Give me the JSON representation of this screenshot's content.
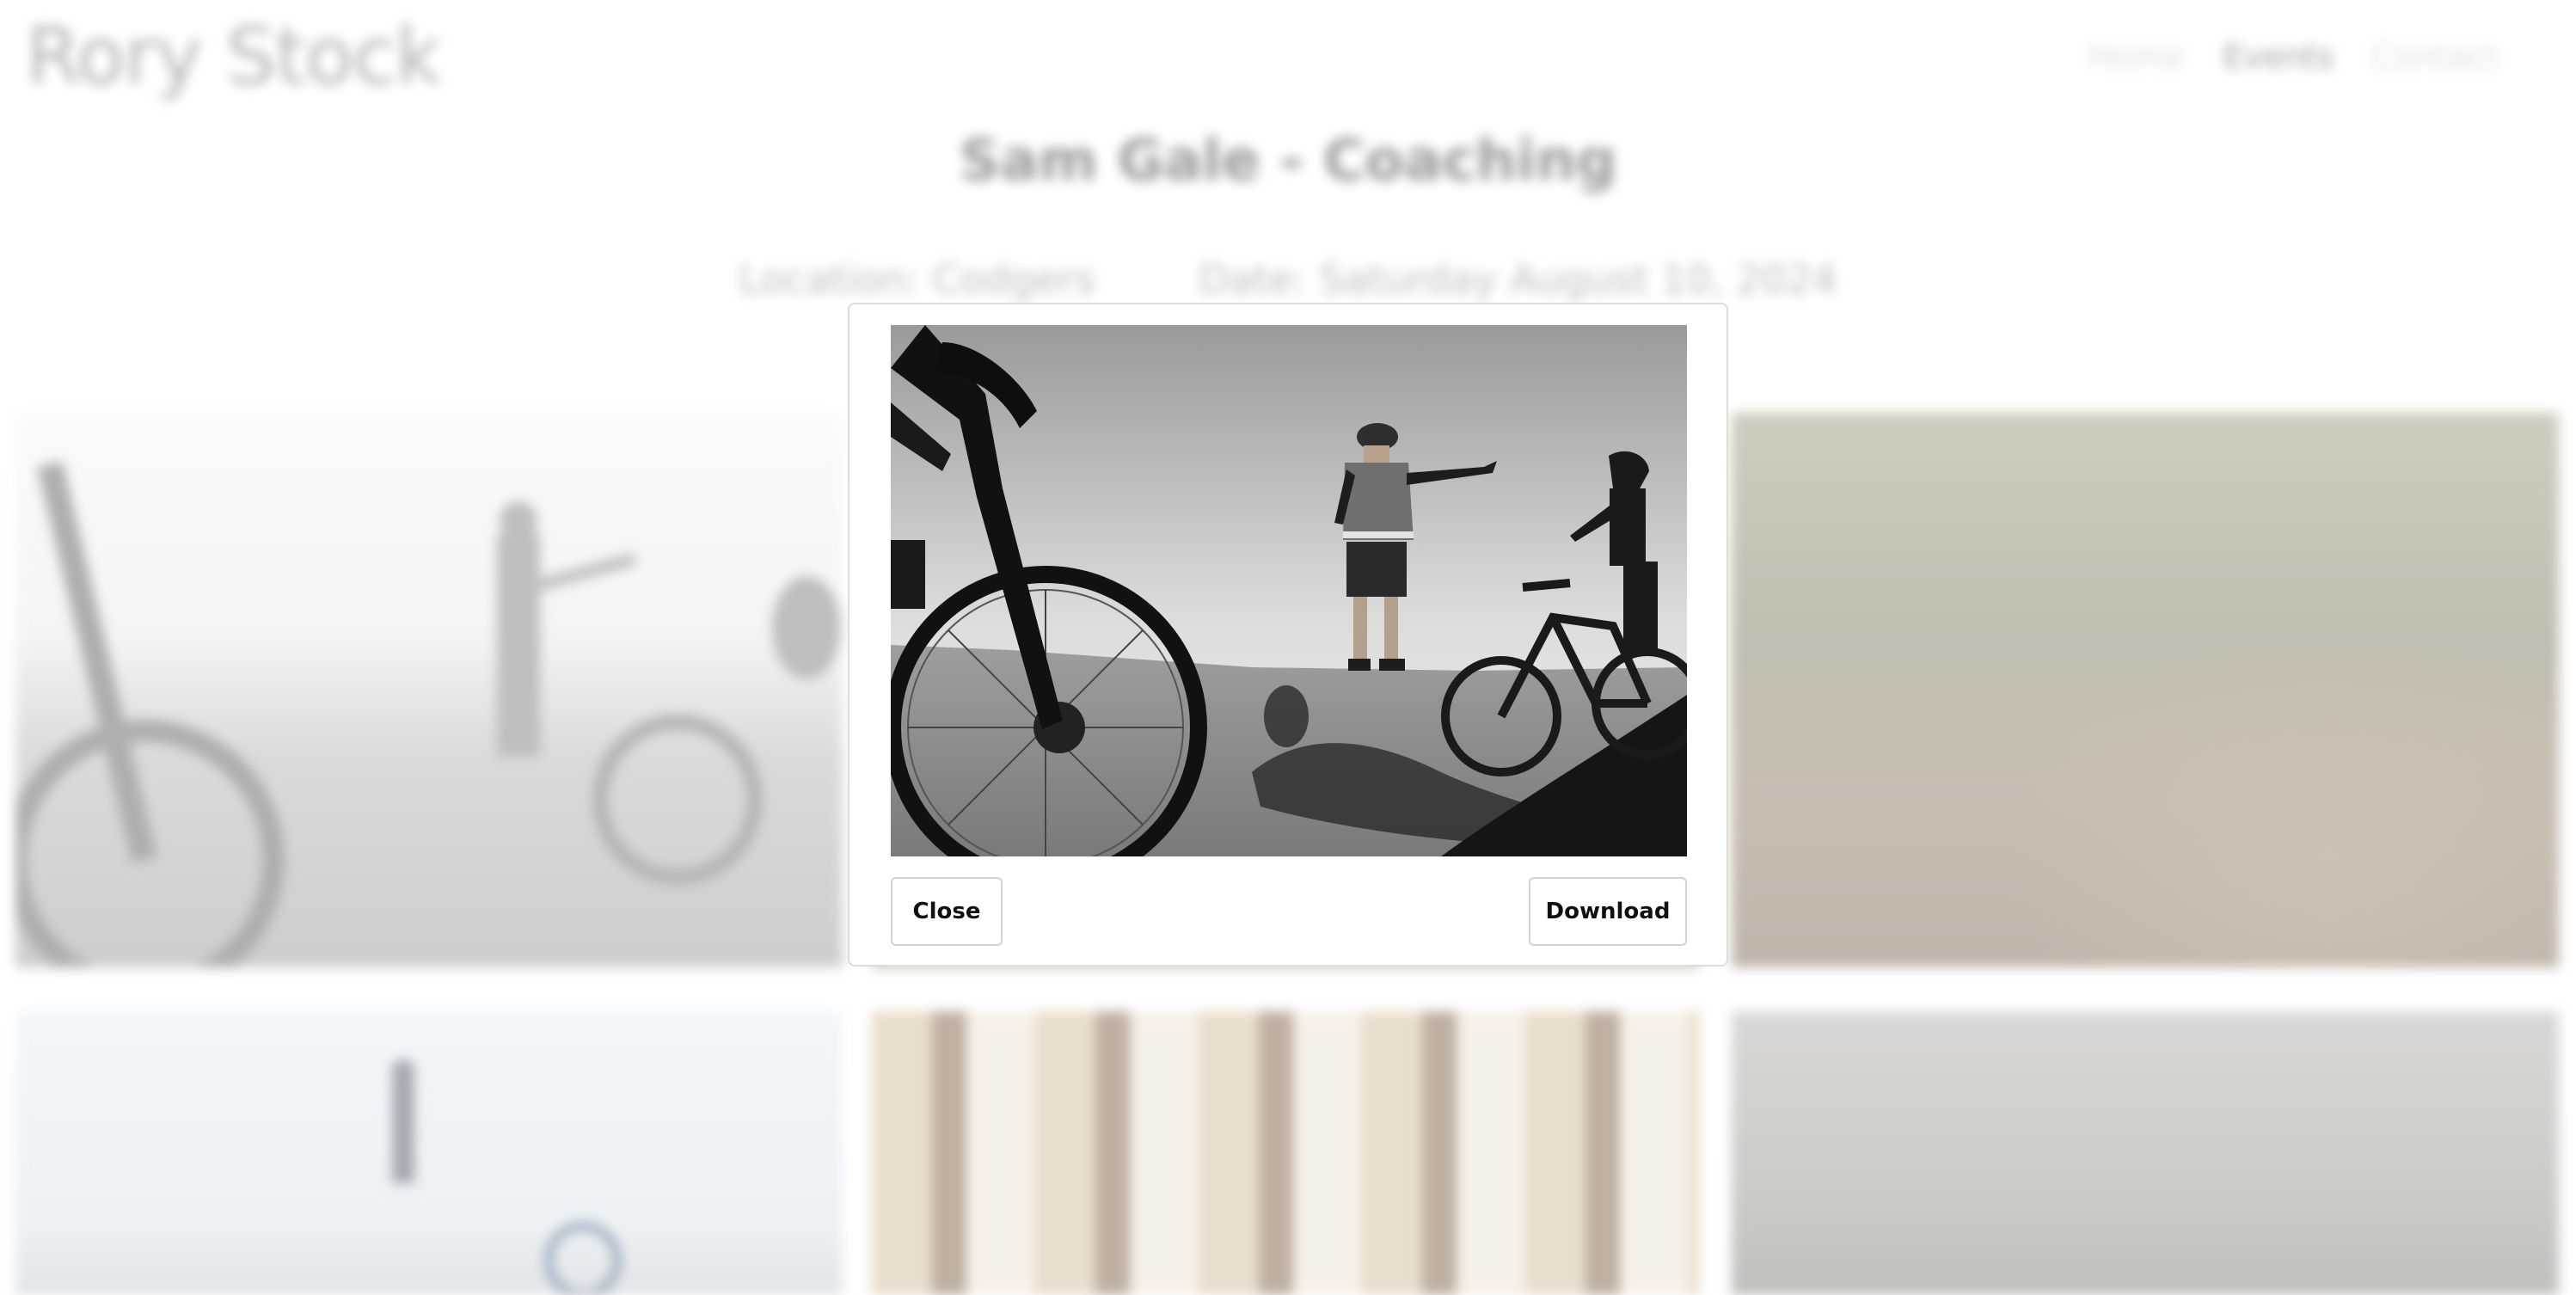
{
  "site": {
    "title": "Rory Stock"
  },
  "nav": {
    "items": [
      "Home",
      "Events",
      "Contact"
    ],
    "active": "Events"
  },
  "event": {
    "title": "Sam Gale - Coaching",
    "location": "Location: Codgers",
    "date": "Date: Saturday August 10, 2024"
  },
  "gallery": {
    "photos": [
      "bw-coaching-ridge-pointing",
      "forest-rider-tan",
      "dirt-jump-trees",
      "rider-sky-bike",
      "pine-forest-riders",
      "misty-forest-rider"
    ]
  },
  "modal": {
    "image": "bw-coaching-ridge-pointing",
    "close_label": "Close",
    "download_label": "Download"
  }
}
